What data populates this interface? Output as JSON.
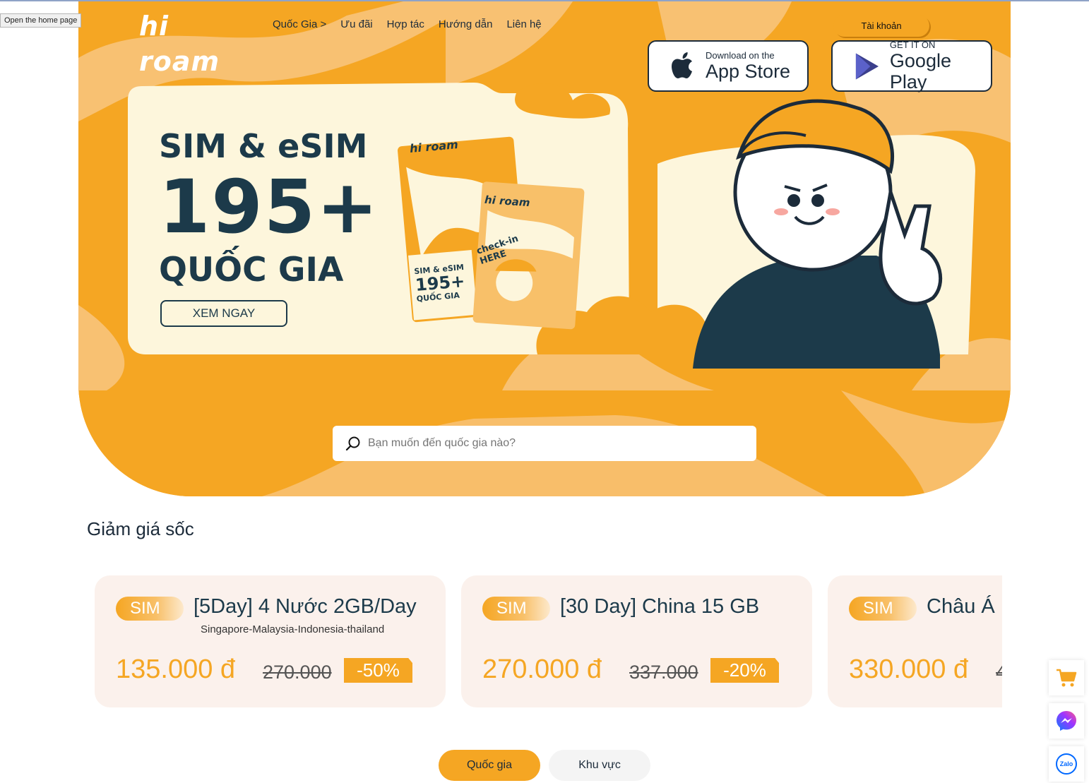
{
  "browser": {
    "tooltip": "Open the home page"
  },
  "header": {
    "logo_text": "hi roam",
    "nav": [
      "Quốc Gia >",
      "Ưu đãi",
      "Hợp tác",
      "Hướng dẫn",
      "Liên hệ"
    ],
    "account_label": "Tài khoản"
  },
  "stores": {
    "appstore_small": "Download on the",
    "appstore_big": "App Store",
    "google_small": "GET IT ON",
    "google_big": "Google Play"
  },
  "hero": {
    "line1": "SIM & eSIM",
    "line2": "195+",
    "line3": "QUỐC GIA",
    "cta": "XEM NGAY",
    "card_logo": "hi roam",
    "card_checkin": "check-in HERE",
    "card_line1": "SIM & eSIM",
    "card_line2": "195+",
    "card_line3": "QUỐC GIA"
  },
  "search": {
    "placeholder": "Bạn muốn đến quốc gia nào?"
  },
  "deals": {
    "title": "Giảm giá sốc",
    "items": [
      {
        "tag": "SIM",
        "name": "[5Day] 4 Nước 2GB/Day",
        "sub": "Singapore-Malaysia-Indonesia-thailand",
        "price": "135.000 đ",
        "old": "270.000",
        "pct": "-50%"
      },
      {
        "tag": "SIM",
        "name": "[30 Day] China 15 GB",
        "sub": "",
        "price": "270.000 đ",
        "old": "337.000",
        "pct": "-20%"
      },
      {
        "tag": "SIM",
        "name": "Châu Á",
        "sub": "",
        "price": "330.000 đ",
        "old": "4",
        "pct": ""
      }
    ]
  },
  "tabs": {
    "country": "Quốc gia",
    "region": "Khu vực"
  },
  "floating": {
    "zalo": "Zalo"
  },
  "colors": {
    "brand": "#f5a623",
    "dark": "#1c3a4a",
    "card_bg": "#fbf1ec"
  }
}
